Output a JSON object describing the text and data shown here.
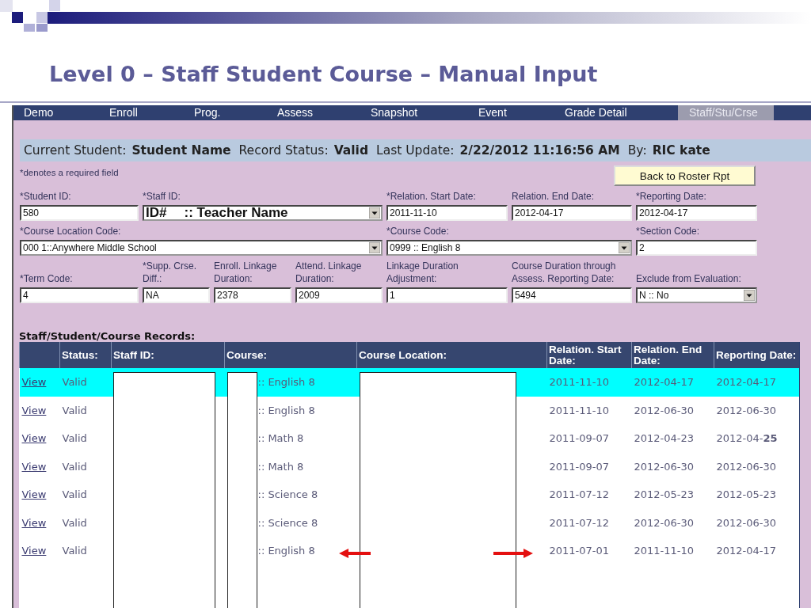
{
  "slide": {
    "title": "Level 0 – Staff Student Course – Manual Input"
  },
  "nav": {
    "tabs": [
      {
        "label": "Demo",
        "selected": false
      },
      {
        "label": "Enroll",
        "selected": false
      },
      {
        "label": "Prog.",
        "selected": false
      },
      {
        "label": "Assess",
        "selected": false
      },
      {
        "label": "Snapshot",
        "selected": false
      },
      {
        "label": "Event",
        "selected": false
      },
      {
        "label": "Grade Detail",
        "selected": false
      },
      {
        "label": "Staff/Stu/Crse",
        "selected": true
      }
    ]
  },
  "record_bar": {
    "items": [
      {
        "label": "Current Student:",
        "value": "Student Name"
      },
      {
        "label": "Record Status:",
        "value": "Valid"
      },
      {
        "label": "Last Update:",
        "value": "2/22/2012 11:16:56 AM"
      },
      {
        "label": "By:",
        "value": "RIC kate"
      }
    ]
  },
  "required_note": "*denotes a required field",
  "back_button": "Back to Roster Rpt",
  "field_rows": [
    [
      {
        "kind": "text",
        "label": "*Student ID:",
        "value": "580"
      },
      {
        "kind": "staff",
        "label": "*Staff ID:",
        "id": "ID#",
        "name": ":: Teacher Name"
      },
      {
        "kind": "text",
        "label": "*Relation. Start Date:",
        "value": "2011-11-10"
      },
      {
        "kind": "text",
        "label": "Relation. End Date:",
        "value": "2012-04-17"
      },
      {
        "kind": "text",
        "label": "*Reporting Date:",
        "value": "2012-04-17"
      }
    ],
    [
      {
        "kind": "select",
        "label": "*Course Location Code:",
        "value": "000 1::Anywhere Middle School"
      },
      {
        "kind": "select",
        "label": "*Course Code:",
        "value": "0999 :: English 8"
      },
      {
        "kind": "text",
        "label": "*Section Code:",
        "value": "2"
      }
    ],
    [
      {
        "kind": "text",
        "label": "*Term Code:",
        "value": "4"
      },
      {
        "kind": "text",
        "label": "*Supp. Crse. Diff.:",
        "value": "NA"
      },
      {
        "kind": "text",
        "label": "Enroll. Linkage Duration:",
        "value": "2378"
      },
      {
        "kind": "text",
        "label": "Attend. Linkage Duration:",
        "value": "2009"
      },
      {
        "kind": "text",
        "label": "Linkage Duration Adjustment:",
        "value": "1"
      },
      {
        "kind": "text",
        "label": "Course Duration through Assess. Reporting Date:",
        "value": "5494"
      },
      {
        "kind": "select",
        "label": "Exclude from Evaluation:",
        "value": "N :: No"
      }
    ]
  ],
  "records": {
    "title": "Staff/Student/Course Records:",
    "columns": [
      "Status:",
      "Staff ID:",
      "Course:",
      "Course Location:",
      "Relation. Start Date:",
      "Relation. End Date:",
      "Reporting Date:"
    ],
    "rows": [
      {
        "selected": true,
        "link": "View",
        "status": "Valid",
        "course": ":: English 8",
        "start": "2011-11-10",
        "end": "2012-04-17",
        "reporting": "2012-04-17"
      },
      {
        "selected": false,
        "link": "View",
        "status": "Valid",
        "course": ":: English 8",
        "start": "2011-11-10",
        "end": "2012-06-30",
        "reporting": "2012-06-30"
      },
      {
        "selected": false,
        "link": "View",
        "status": "Valid",
        "course": ":: Math 8",
        "start": "2011-09-07",
        "end": "2012-04-23",
        "reporting": "2012-04-**25**"
      },
      {
        "selected": false,
        "link": "View",
        "status": "Valid",
        "course": ":: Math 8",
        "start": "2011-09-07",
        "end": "2012-06-30",
        "reporting": "2012-06-30"
      },
      {
        "selected": false,
        "link": "View",
        "status": "Valid",
        "course": ":: Science 8",
        "start": "2011-07-12",
        "end": "2012-05-23",
        "reporting": "2012-05-23"
      },
      {
        "selected": false,
        "link": "View",
        "status": "Valid",
        "course": ":: Science 8",
        "start": "2011-07-12",
        "end": "2012-06-30",
        "reporting": "2012-06-30"
      },
      {
        "selected": false,
        "link": "View",
        "status": "Valid",
        "course": ":: English 8",
        "start": "2011-07-01",
        "end": "2011-11-10",
        "reporting": "2012-04-17"
      }
    ]
  }
}
